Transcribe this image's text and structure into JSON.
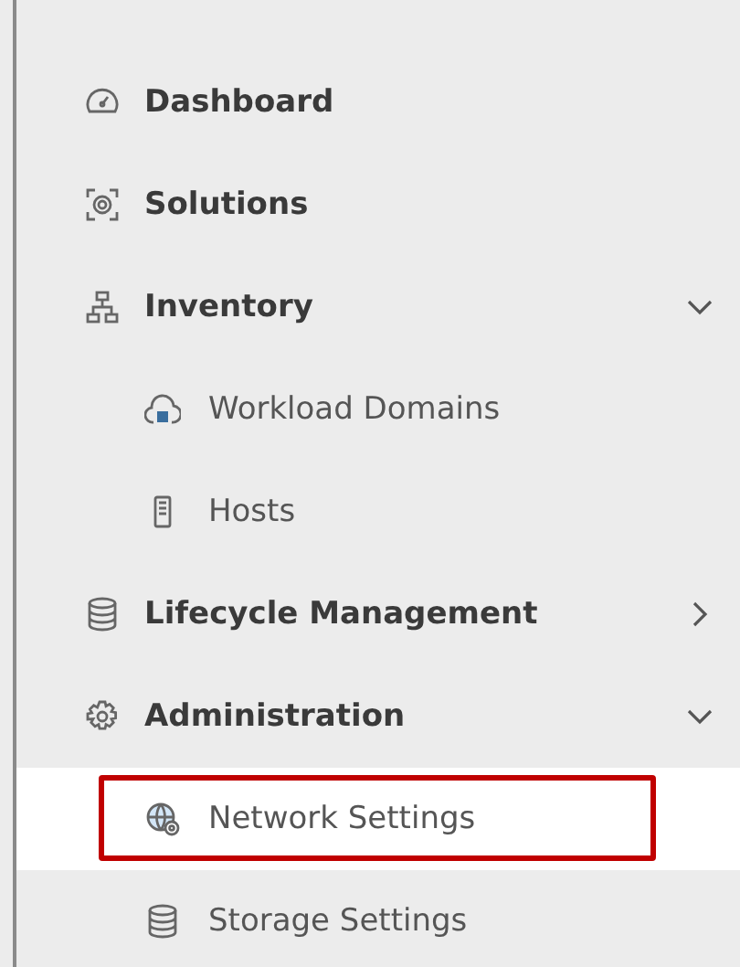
{
  "nav": [
    {
      "label": "Dashboard"
    },
    {
      "label": "Solutions"
    },
    {
      "label": "Inventory",
      "expanded": true,
      "children": [
        {
          "label": "Workload Domains",
          "selected": false,
          "highlighted": false
        },
        {
          "label": "Hosts",
          "selected": false,
          "highlighted": false
        }
      ]
    },
    {
      "label": "Lifecycle Management",
      "expanded": false
    },
    {
      "label": "Administration",
      "expanded": true,
      "children": [
        {
          "label": "Network Settings",
          "selected": true,
          "highlighted": true
        },
        {
          "label": "Storage Settings",
          "selected": false,
          "highlighted": false
        }
      ]
    }
  ]
}
